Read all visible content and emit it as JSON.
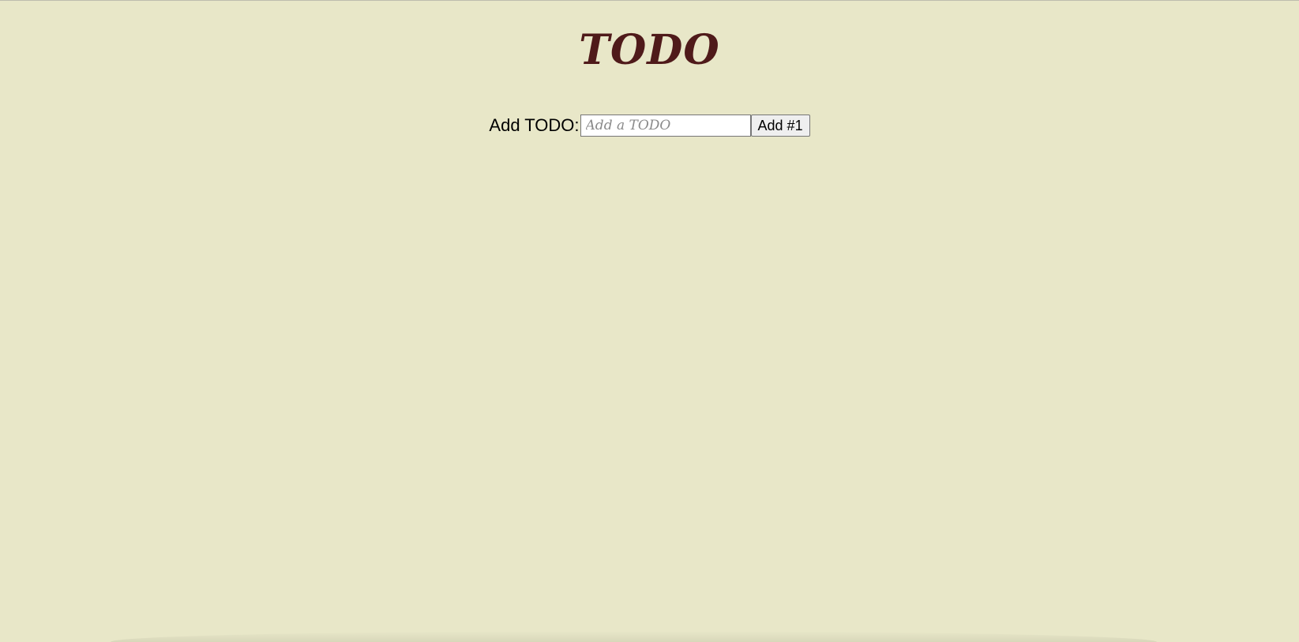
{
  "header": {
    "title": "TODO"
  },
  "add_form": {
    "label": "Add TODO:",
    "input_value": "",
    "input_placeholder": "Add a TODO",
    "button_label": "Add #1"
  },
  "colors": {
    "background": "#e8e7c8",
    "title": "#4f1a1a"
  }
}
